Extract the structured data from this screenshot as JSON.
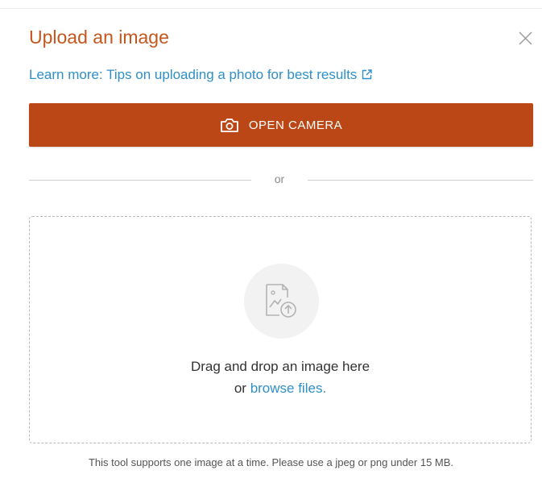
{
  "dialog": {
    "title": "Upload an image",
    "learn_more_label": "Learn more: Tips on uploading a photo for best results",
    "camera_button_label": "OPEN CAMERA",
    "divider_text": "or",
    "dropzone": {
      "line1": "Drag and drop an image here",
      "line2_prefix": "or",
      "browse_label": "browse files."
    },
    "footnote": "This tool supports one image at a time. Please use a jpeg or png under 15 MB."
  },
  "colors": {
    "title": "#c4571e",
    "link": "#2f8fc7",
    "button_bg": "#bb4716",
    "button_text": "#ffffff",
    "dropzone_border": "#b9b9b9",
    "icon_circle": "#f2f2f2"
  },
  "icons": {
    "close": "close-icon",
    "external_link": "external-link-icon",
    "camera": "camera-icon",
    "image_upload": "image-upload-icon"
  }
}
